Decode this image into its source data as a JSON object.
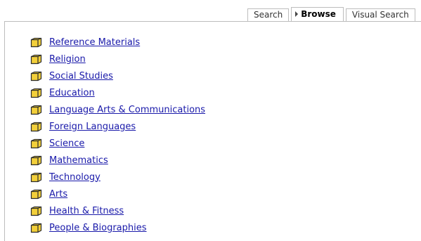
{
  "tabs": [
    {
      "label": "Search",
      "active": false
    },
    {
      "label": "Browse",
      "active": true
    },
    {
      "label": "Visual Search",
      "active": false
    }
  ],
  "categories": [
    "Reference Materials",
    "Religion",
    "Social Studies",
    "Education",
    "Language Arts & Communications",
    "Foreign Languages",
    "Science",
    "Mathematics",
    "Technology",
    "Arts",
    "Health & Fitness",
    "People & Biographies"
  ],
  "icon": "folder-icon",
  "colors": {
    "link": "#1a1aaa",
    "folder_fill": "#f2cf3a",
    "folder_outline": "#2b2b2b",
    "tab_border": "#bdbdbd"
  }
}
